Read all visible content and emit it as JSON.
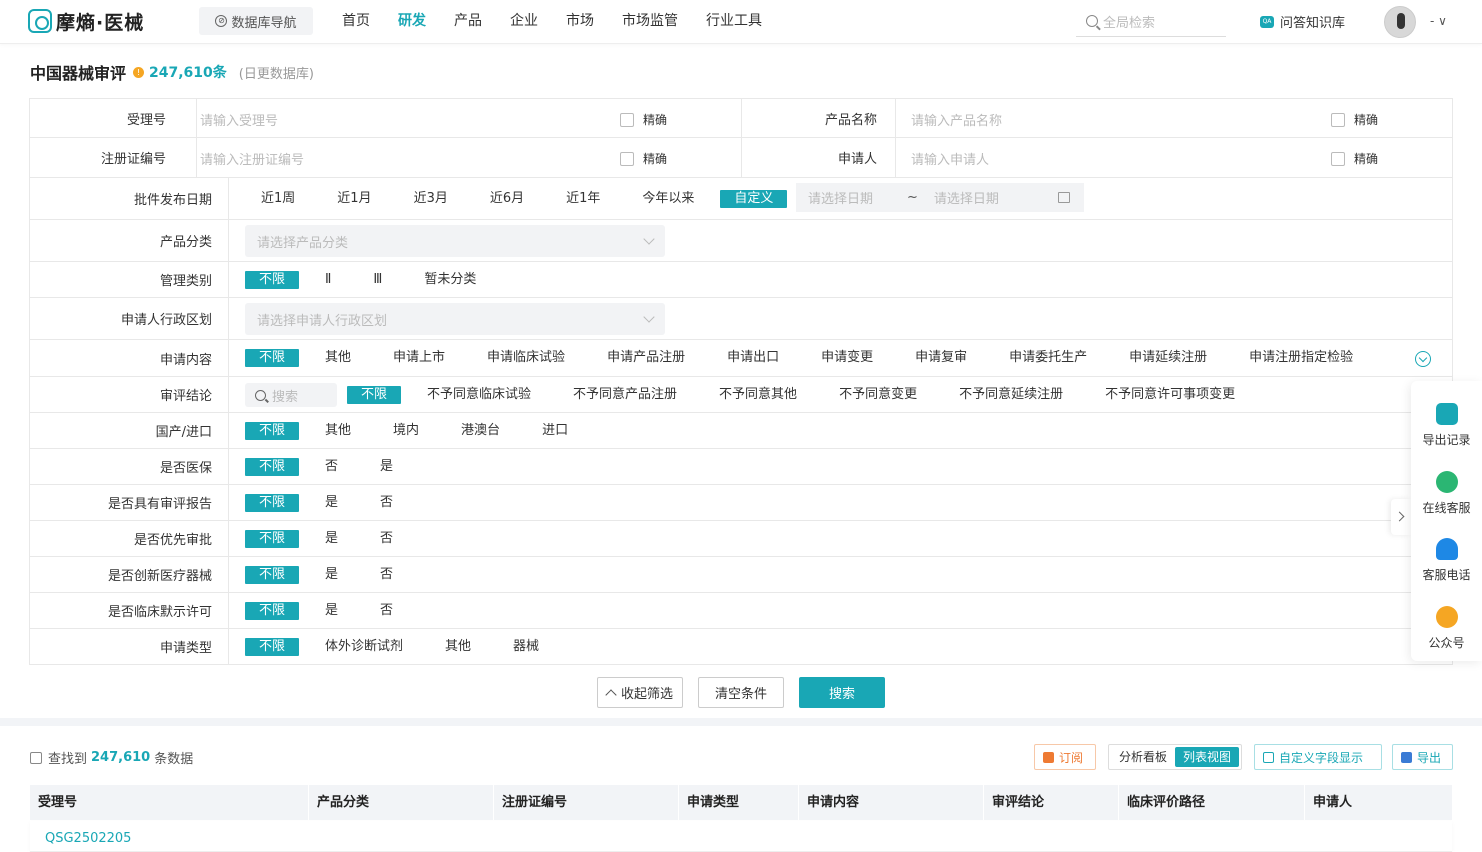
{
  "header": {
    "logo_text": "摩熵·医械",
    "db_nav": "数据库导航",
    "nav": [
      "首页",
      "研发",
      "产品",
      "企业",
      "市场",
      "市场监管",
      "行业工具"
    ],
    "active_nav": "研发",
    "search_placeholder": "全局检索",
    "qa": "问答知识库",
    "user": "- ∨"
  },
  "page": {
    "title": "中国器械审评",
    "count": "247,610条",
    "subtitle": "(日更数据库)"
  },
  "filters": {
    "accept_no": {
      "label": "受理号",
      "placeholder": "请输入受理号",
      "exact": "精确"
    },
    "product_name": {
      "label": "产品名称",
      "placeholder": "请输入产品名称",
      "exact": "精确"
    },
    "reg_no": {
      "label": "注册证编号",
      "placeholder": "请输入注册证编号",
      "exact": "精确"
    },
    "applicant": {
      "label": "申请人",
      "placeholder": "请输入申请人",
      "exact": "精确"
    },
    "publish_date": {
      "label": "批件发布日期",
      "options": [
        "近1周",
        "近1月",
        "近3月",
        "近6月",
        "近1年",
        "今年以来",
        "自定义"
      ],
      "selected": "自定义",
      "start_placeholder": "请选择日期",
      "sep": "~",
      "end_placeholder": "请选择日期"
    },
    "category": {
      "label": "产品分类",
      "placeholder": "请选择产品分类"
    },
    "mgmt_class": {
      "label": "管理类别",
      "options": [
        "不限",
        "Ⅱ",
        "Ⅲ",
        "暂未分类"
      ],
      "selected": "不限"
    },
    "region": {
      "label": "申请人行政区划",
      "placeholder": "请选择申请人行政区划"
    },
    "content": {
      "label": "申请内容",
      "options": [
        "不限",
        "其他",
        "申请上市",
        "申请临床试验",
        "申请产品注册",
        "申请出口",
        "申请变更",
        "申请复审",
        "申请委托生产",
        "申请延续注册",
        "申请注册指定检验"
      ],
      "selected": "不限"
    },
    "conclusion": {
      "label": "审评结论",
      "search_placeholder": "搜索",
      "options": [
        "不限",
        "不予同意临床试验",
        "不予同意产品注册",
        "不予同意其他",
        "不予同意变更",
        "不予同意延续注册",
        "不予同意许可事项变更"
      ],
      "selected": "不限"
    },
    "origin": {
      "label": "国产/进口",
      "options": [
        "不限",
        "其他",
        "境内",
        "港澳台",
        "进口"
      ],
      "selected": "不限"
    },
    "insurance": {
      "label": "是否医保",
      "options": [
        "不限",
        "否",
        "是"
      ],
      "selected": "不限"
    },
    "report": {
      "label": "是否具有审评报告",
      "options": [
        "不限",
        "是",
        "否"
      ],
      "selected": "不限"
    },
    "priority": {
      "label": "是否优先审批",
      "options": [
        "不限",
        "是",
        "否"
      ],
      "selected": "不限"
    },
    "innovative": {
      "label": "是否创新医疗器械",
      "options": [
        "不限",
        "是",
        "否"
      ],
      "selected": "不限"
    },
    "implied": {
      "label": "是否临床默示许可",
      "options": [
        "不限",
        "是",
        "否"
      ],
      "selected": "不限"
    },
    "apply_type": {
      "label": "申请类型",
      "options": [
        "不限",
        "体外诊断试剂",
        "其他",
        "器械"
      ],
      "selected": "不限"
    }
  },
  "actions": {
    "collapse": "收起筛选",
    "clear": "清空条件",
    "search": "搜索"
  },
  "results": {
    "found_prefix": "查找到",
    "found_count": "247,610",
    "found_suffix": "条数据",
    "subscribe": "订阅",
    "views": [
      "分析看板",
      "列表视图"
    ],
    "active_view": "列表视图",
    "custom_fields": "自定义字段显示",
    "export": "导出",
    "columns": [
      "受理号",
      "产品分类",
      "注册证编号",
      "申请类型",
      "申请内容",
      "审评结论",
      "临床评价路径",
      "申请人"
    ],
    "rows": [
      [
        "QSG2502205"
      ]
    ]
  },
  "sidebar": [
    {
      "label": "导出记录",
      "icon": "export-record-icon",
      "color": "#19a7b5"
    },
    {
      "label": "在线客服",
      "icon": "chat-icon",
      "color": "#2bb673"
    },
    {
      "label": "客服电话",
      "icon": "headset-icon",
      "color": "#1e88e5"
    },
    {
      "label": "公众号",
      "icon": "badge-icon",
      "color": "#f5a623"
    }
  ],
  "colors": {
    "accent": "#19a7b5",
    "orange": "#ee7a33"
  }
}
